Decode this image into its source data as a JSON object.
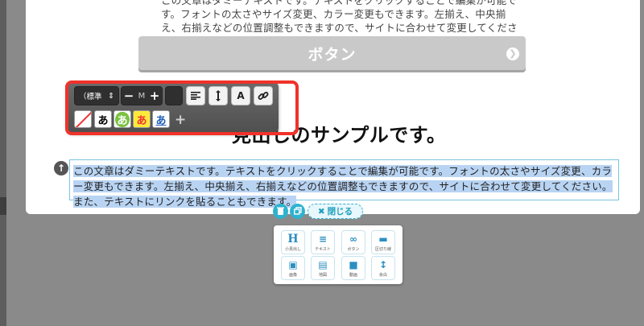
{
  "page": {
    "intro_text": "この文章はダミーテキストです。テキストをクリックすることで編集が可能です。フォントの太さやサイズ変更、カラー変更もできます。左揃え、中央揃え、右揃えなどの位置調整もできますので、サイトに合わせて変更してください。また、テキストにリンクを貼ることもできます。",
    "button_label": "ボタン",
    "heading": "見出しのサンプルです。",
    "selected_text": "この文章はダミーテキストです。テキストをクリックすることで編集が可能です。フォントの太さやサイズ変更、カラー変更もできます。左揃え、中央揃え、右揃えなどの位置調整もできますので、サイトに合わせて変更してください。また、テキストにリンクを貼ることもできます。"
  },
  "toolbar": {
    "font_select": "（標準",
    "size_minus": "−",
    "size_value": "M",
    "size_plus": "+",
    "font_button": "A",
    "swatch_glyph": "あ",
    "add_swatch": "+"
  },
  "actions": {
    "close_label": "閉じる",
    "close_x": "✖"
  },
  "palette": {
    "items": [
      {
        "icon": "H",
        "label": "小見出し"
      },
      {
        "icon": "≡",
        "label": "テキスト"
      },
      {
        "icon": "∞",
        "label": "ボタン"
      },
      {
        "icon": "▬",
        "label": "区切り線"
      },
      {
        "icon": "▣",
        "label": "画像"
      },
      {
        "icon": "▤",
        "label": "地図"
      },
      {
        "icon": "■",
        "label": "動画"
      },
      {
        "icon": "↕",
        "label": "余白"
      }
    ]
  },
  "colors": {
    "accent": "#2eb3cf",
    "highlight_frame": "#f0322a",
    "selection": "#b9d4f3"
  }
}
